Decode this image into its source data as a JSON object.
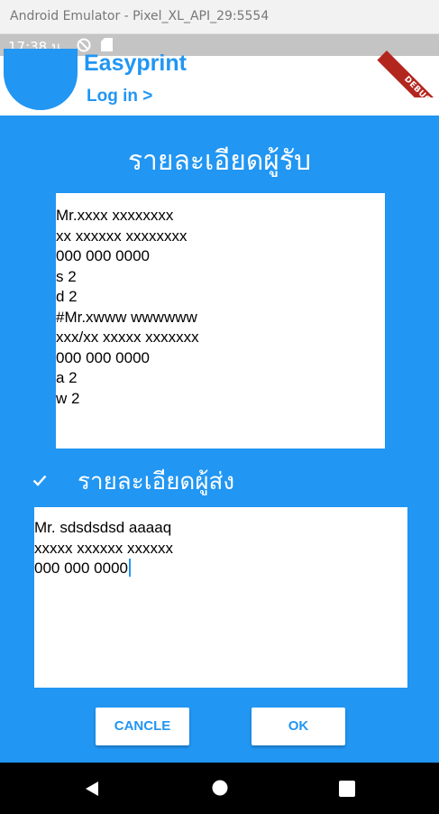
{
  "window": {
    "title": "Android Emulator - Pixel_XL_API_29:5554"
  },
  "status_bar": {
    "time": "17:38 น.",
    "icons": [
      "do-not-disturb-icon",
      "sd-card-icon"
    ]
  },
  "debug_banner": {
    "label": "DEBUG",
    "color": "#b3261e"
  },
  "header": {
    "app_title": "Easyprint",
    "login_link": "Log in >"
  },
  "receiver": {
    "heading": "รายละเอียดผู้รับ",
    "lines": [
      "Mr.xxxx xxxxxxxx",
      "xx xxxxxx xxxxxxxx",
      "000 000 0000",
      "s 2",
      "d 2",
      "#Mr.xwww wwwwww",
      "xxx/xx xxxxx xxxxxxx",
      "000 000 0000",
      "a 2",
      "w 2"
    ]
  },
  "sender": {
    "checked": true,
    "heading": "รายละเอียดผู้ส่ง",
    "lines": [
      "Mr. sdsdsdsd aaaaq",
      "xxxxx xxxxxx xxxxxx",
      "000 000 0000"
    ]
  },
  "buttons": {
    "cancel": "CANCLE",
    "ok": "OK"
  },
  "nav_bar": {
    "icons": [
      "back-icon",
      "home-icon",
      "recents-icon"
    ]
  },
  "colors": {
    "accent": "#2196f3",
    "background": "#2196f3",
    "card": "#ffffff"
  }
}
